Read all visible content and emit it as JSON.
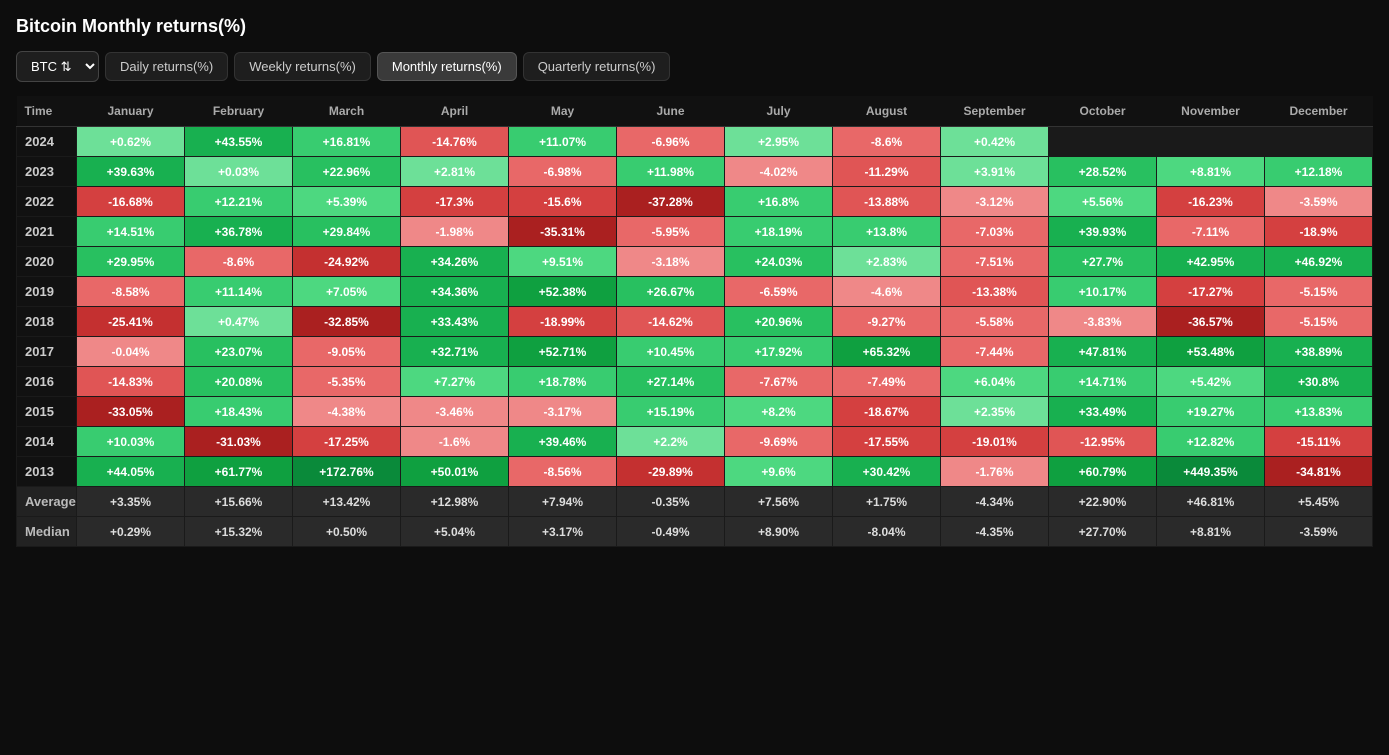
{
  "title": "Bitcoin Monthly returns(%)",
  "asset": "BTC",
  "tabs": [
    {
      "label": "Daily returns(%)",
      "active": false
    },
    {
      "label": "Weekly returns(%)",
      "active": false
    },
    {
      "label": "Monthly returns(%)",
      "active": true
    },
    {
      "label": "Quarterly returns(%)",
      "active": false
    }
  ],
  "columns": [
    "Time",
    "January",
    "February",
    "March",
    "April",
    "May",
    "June",
    "July",
    "August",
    "September",
    "October",
    "November",
    "December"
  ],
  "rows": [
    {
      "year": "2024",
      "values": [
        "+0.62%",
        "+43.55%",
        "+16.81%",
        "-14.76%",
        "+11.07%",
        "-6.96%",
        "+2.95%",
        "-8.6%",
        "+0.42%",
        "",
        "",
        ""
      ]
    },
    {
      "year": "2023",
      "values": [
        "+39.63%",
        "+0.03%",
        "+22.96%",
        "+2.81%",
        "-6.98%",
        "+11.98%",
        "-4.02%",
        "-11.29%",
        "+3.91%",
        "+28.52%",
        "+8.81%",
        "+12.18%"
      ]
    },
    {
      "year": "2022",
      "values": [
        "-16.68%",
        "+12.21%",
        "+5.39%",
        "-17.3%",
        "-15.6%",
        "-37.28%",
        "+16.8%",
        "-13.88%",
        "-3.12%",
        "+5.56%",
        "-16.23%",
        "-3.59%"
      ]
    },
    {
      "year": "2021",
      "values": [
        "+14.51%",
        "+36.78%",
        "+29.84%",
        "-1.98%",
        "-35.31%",
        "-5.95%",
        "+18.19%",
        "+13.8%",
        "-7.03%",
        "+39.93%",
        "-7.11%",
        "-18.9%"
      ]
    },
    {
      "year": "2020",
      "values": [
        "+29.95%",
        "-8.6%",
        "-24.92%",
        "+34.26%",
        "+9.51%",
        "-3.18%",
        "+24.03%",
        "+2.83%",
        "-7.51%",
        "+27.7%",
        "+42.95%",
        "+46.92%"
      ]
    },
    {
      "year": "2019",
      "values": [
        "-8.58%",
        "+11.14%",
        "+7.05%",
        "+34.36%",
        "+52.38%",
        "+26.67%",
        "-6.59%",
        "-4.6%",
        "-13.38%",
        "+10.17%",
        "-17.27%",
        "-5.15%"
      ]
    },
    {
      "year": "2018",
      "values": [
        "-25.41%",
        "+0.47%",
        "-32.85%",
        "+33.43%",
        "-18.99%",
        "-14.62%",
        "+20.96%",
        "-9.27%",
        "-5.58%",
        "-3.83%",
        "-36.57%",
        "-5.15%"
      ]
    },
    {
      "year": "2017",
      "values": [
        "-0.04%",
        "+23.07%",
        "-9.05%",
        "+32.71%",
        "+52.71%",
        "+10.45%",
        "+17.92%",
        "+65.32%",
        "-7.44%",
        "+47.81%",
        "+53.48%",
        "+38.89%"
      ]
    },
    {
      "year": "2016",
      "values": [
        "-14.83%",
        "+20.08%",
        "-5.35%",
        "+7.27%",
        "+18.78%",
        "+27.14%",
        "-7.67%",
        "-7.49%",
        "+6.04%",
        "+14.71%",
        "+5.42%",
        "+30.8%"
      ]
    },
    {
      "year": "2015",
      "values": [
        "-33.05%",
        "+18.43%",
        "-4.38%",
        "-3.46%",
        "-3.17%",
        "+15.19%",
        "+8.2%",
        "-18.67%",
        "+2.35%",
        "+33.49%",
        "+19.27%",
        "+13.83%"
      ]
    },
    {
      "year": "2014",
      "values": [
        "+10.03%",
        "-31.03%",
        "-17.25%",
        "-1.6%",
        "+39.46%",
        "+2.2%",
        "-9.69%",
        "-17.55%",
        "-19.01%",
        "-12.95%",
        "+12.82%",
        "-15.11%"
      ]
    },
    {
      "year": "2013",
      "values": [
        "+44.05%",
        "+61.77%",
        "+172.76%",
        "+50.01%",
        "-8.56%",
        "-29.89%",
        "+9.6%",
        "+30.42%",
        "-1.76%",
        "+60.79%",
        "+449.35%",
        "-34.81%"
      ]
    }
  ],
  "averages": [
    "+3.35%",
    "+15.66%",
    "+13.42%",
    "+12.98%",
    "+7.94%",
    "-0.35%",
    "+7.56%",
    "+1.75%",
    "-4.34%",
    "+22.90%",
    "+46.81%",
    "+5.45%"
  ],
  "medians": [
    "+0.29%",
    "+15.32%",
    "+0.50%",
    "+5.04%",
    "+3.17%",
    "-0.49%",
    "+8.90%",
    "-8.04%",
    "-4.35%",
    "+27.70%",
    "+8.81%",
    "-3.59%"
  ]
}
